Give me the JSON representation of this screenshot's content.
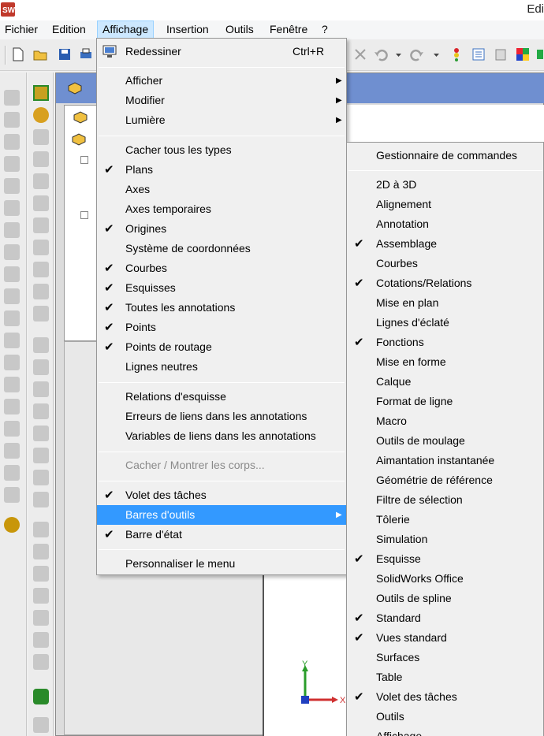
{
  "window": {
    "title": "Edi"
  },
  "menubar": [
    "Fichier",
    "Edition",
    "Affichage",
    "Insertion",
    "Outils",
    "Fenêtre",
    "?"
  ],
  "affichage_menu": {
    "redraw": {
      "label": "Redessiner",
      "shortcut": "Ctrl+R",
      "icon": "redraw-icon"
    },
    "submenus": [
      "Afficher",
      "Modifier",
      "Lumière"
    ],
    "visibility": [
      {
        "label": "Cacher tous les types",
        "checked": false
      },
      {
        "label": "Plans",
        "checked": true
      },
      {
        "label": "Axes",
        "checked": false
      },
      {
        "label": "Axes temporaires",
        "checked": false
      },
      {
        "label": "Origines",
        "checked": true
      },
      {
        "label": "Système de coordonnées",
        "checked": false
      },
      {
        "label": "Courbes",
        "checked": true
      },
      {
        "label": "Esquisses",
        "checked": true
      },
      {
        "label": "Toutes les annotations",
        "checked": true
      },
      {
        "label": "Points",
        "checked": true
      },
      {
        "label": "Points de routage",
        "checked": true
      },
      {
        "label": "Lignes neutres",
        "checked": false
      }
    ],
    "relations": [
      "Relations d'esquisse",
      "Erreurs de liens dans les annotations",
      "Variables de liens dans les annotations"
    ],
    "bodies": {
      "label": "Cacher / Montrer les corps...",
      "disabled": true
    },
    "panes": [
      {
        "label": "Volet des tâches",
        "checked": true,
        "submenu": false
      },
      {
        "label": "Barres d'outils",
        "checked": false,
        "submenu": true,
        "highlighted": true
      },
      {
        "label": "Barre d'état",
        "checked": true,
        "submenu": false
      }
    ],
    "customize": "Personnaliser le menu"
  },
  "toolbars_menu": {
    "header": "Gestionnaire de commandes",
    "items": [
      {
        "label": "2D à 3D",
        "checked": false
      },
      {
        "label": "Alignement",
        "checked": false
      },
      {
        "label": "Annotation",
        "checked": false
      },
      {
        "label": "Assemblage",
        "checked": true
      },
      {
        "label": "Courbes",
        "checked": false
      },
      {
        "label": "Cotations/Relations",
        "checked": true
      },
      {
        "label": "Mise en plan",
        "checked": false
      },
      {
        "label": "Lignes d'éclaté",
        "checked": false
      },
      {
        "label": "Fonctions",
        "checked": true
      },
      {
        "label": "Mise en forme",
        "checked": false
      },
      {
        "label": "Calque",
        "checked": false
      },
      {
        "label": "Format de ligne",
        "checked": false
      },
      {
        "label": "Macro",
        "checked": false
      },
      {
        "label": "Outils de moulage",
        "checked": false
      },
      {
        "label": "Aimantation instantanée",
        "checked": false
      },
      {
        "label": "Géométrie de référence",
        "checked": false
      },
      {
        "label": "Filtre de sélection",
        "checked": false
      },
      {
        "label": "Tôlerie",
        "checked": false
      },
      {
        "label": "Simulation",
        "checked": false
      },
      {
        "label": "Esquisse",
        "checked": true
      },
      {
        "label": "SolidWorks Office",
        "checked": false
      },
      {
        "label": "Outils de spline",
        "checked": false
      },
      {
        "label": "Standard",
        "checked": true
      },
      {
        "label": "Vues standard",
        "checked": true
      },
      {
        "label": "Surfaces",
        "checked": false
      },
      {
        "label": "Table",
        "checked": false
      },
      {
        "label": "Volet des tâches",
        "checked": true
      },
      {
        "label": "Outils",
        "checked": false
      },
      {
        "label": "Affichage",
        "checked": false
      }
    ]
  },
  "axis_triad": {
    "y": "Y",
    "x": "X"
  },
  "glyphs": {
    "check": "✔",
    "arrow": "▶"
  },
  "colors": {
    "highlight": "#3399ff",
    "menu_bg": "#f0f0f0",
    "logo_red": "#c0392b"
  }
}
